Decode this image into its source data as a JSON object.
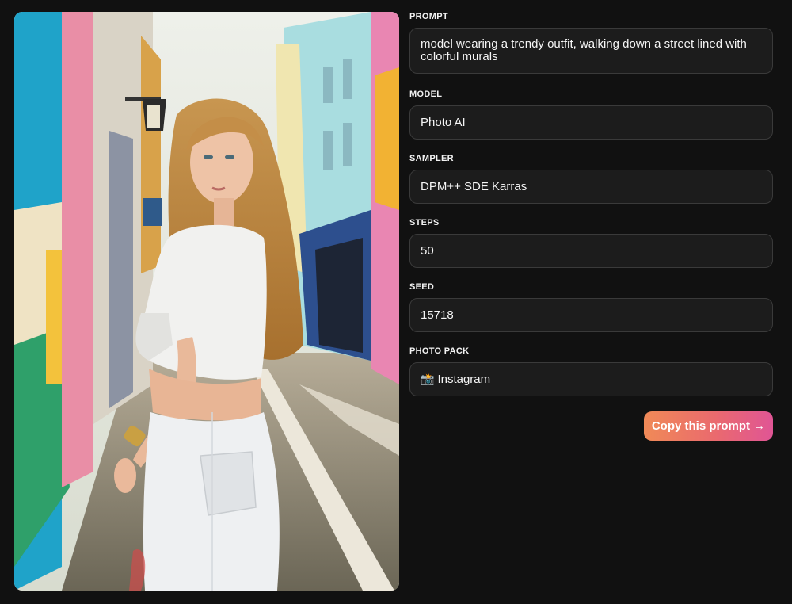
{
  "photo": {
    "alt": ""
  },
  "fields": {
    "prompt": {
      "label": "PROMPT",
      "value": "model wearing a trendy outfit, walking down a street lined with colorful murals"
    },
    "model": {
      "label": "MODEL",
      "value": "Photo AI"
    },
    "sampler": {
      "label": "SAMPLER",
      "value": "DPM++ SDE Karras"
    },
    "steps": {
      "label": "STEPS",
      "value": "50"
    },
    "seed": {
      "label": "SEED",
      "value": "15718"
    },
    "photo_pack": {
      "label": "PHOTO PACK",
      "icon": "camera-icon",
      "value": "Instagram"
    }
  },
  "actions": {
    "copy_label": "Copy this prompt",
    "copy_icon": "arrow-right-icon"
  },
  "colors": {
    "background": "#111111",
    "field_bg": "#1c1c1c",
    "button_start": "#f08a57",
    "button_end": "#e05595"
  }
}
